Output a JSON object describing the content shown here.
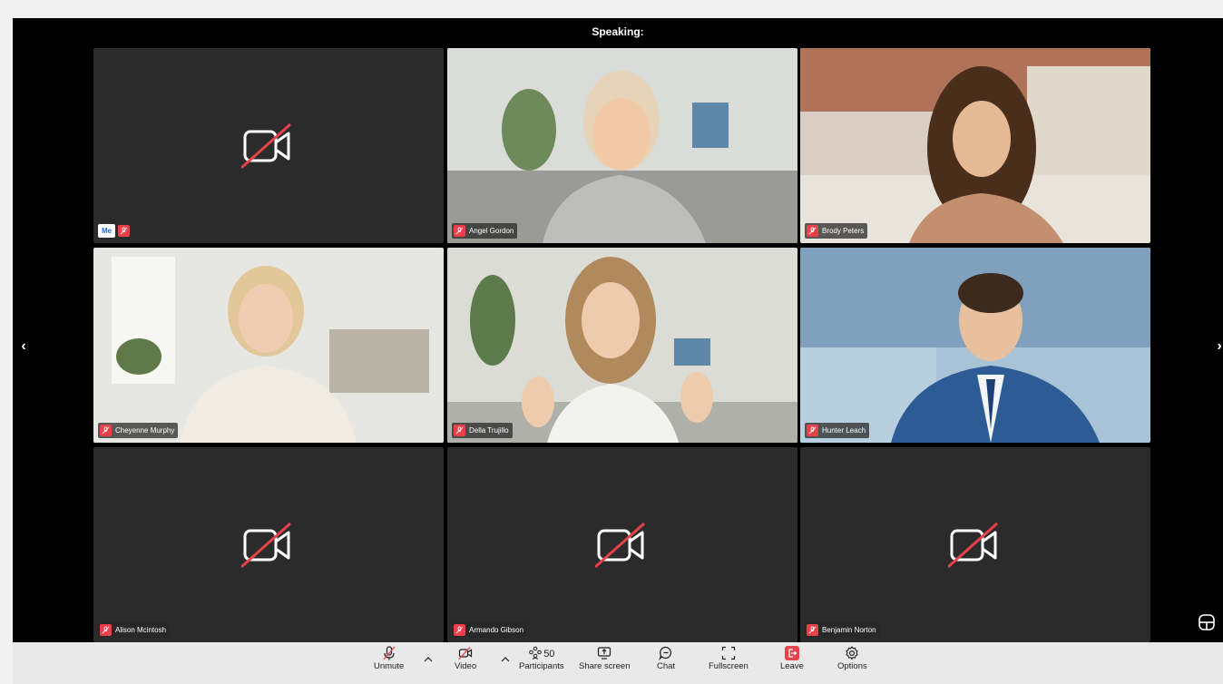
{
  "call": {
    "speaking_label": "Speaking:"
  },
  "self": {
    "me_label": "Me"
  },
  "participants": [
    {
      "name": "Angel Gordon"
    },
    {
      "name": "Brody Peters"
    },
    {
      "name": "Cheyenne Murphy"
    },
    {
      "name": "Della Trujillo"
    },
    {
      "name": "Hunter Leach"
    },
    {
      "name": "Alison Mcintosh"
    },
    {
      "name": "Armando Gibson"
    },
    {
      "name": "Benjamin Norton"
    }
  ],
  "nav": {
    "prev_icon": "‹",
    "next_icon": "›"
  },
  "toolbar": {
    "unmute": "Unmute",
    "video": "Video",
    "participants": "Participants",
    "participants_count": "50",
    "share_screen": "Share screen",
    "chat": "Chat",
    "fullscreen": "Fullscreen",
    "leave": "Leave",
    "options": "Options"
  },
  "colors": {
    "background": "#000000",
    "tile": "#2b2b2c",
    "mute_red": "#e8414a",
    "toolbar": "#e9e9ea",
    "leave_red": "#e8414a"
  }
}
